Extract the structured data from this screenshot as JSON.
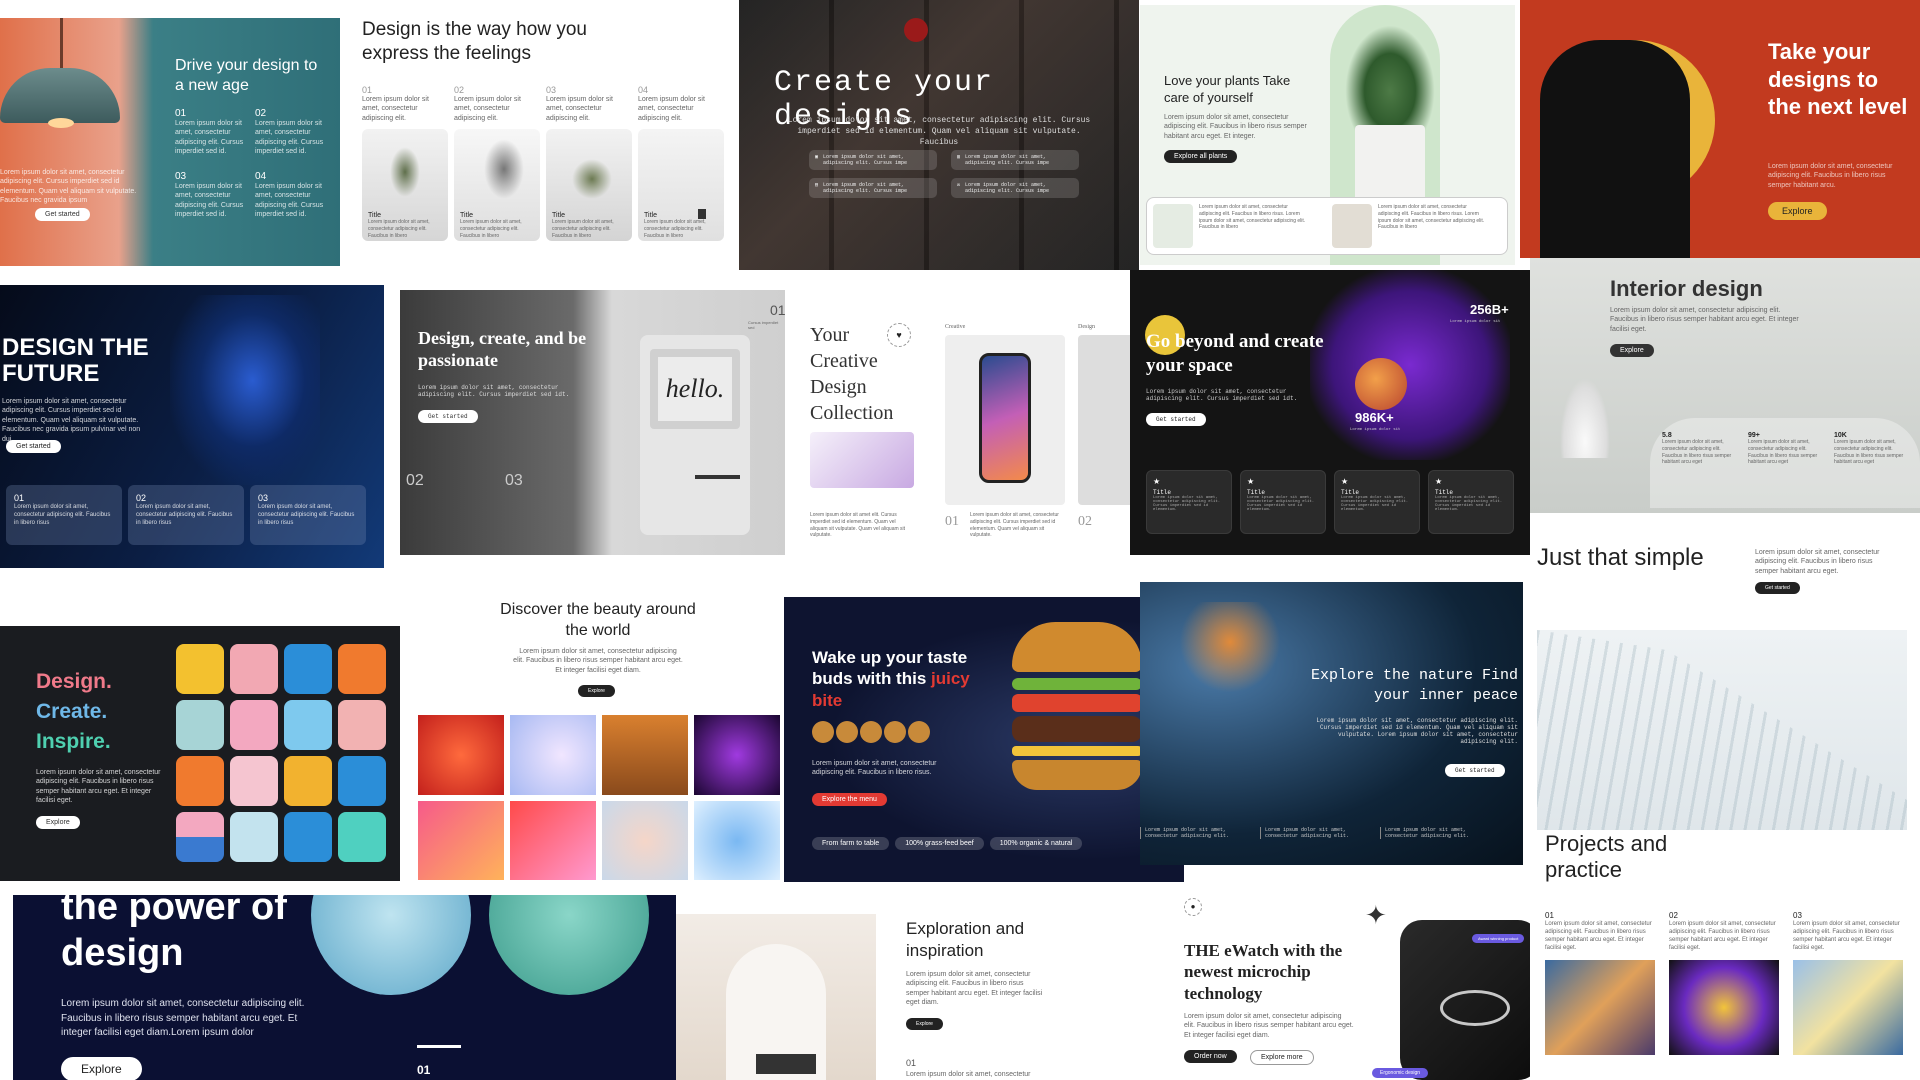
{
  "cards": {
    "lamp": {
      "title": "Drive your design to a new age",
      "nums": [
        "01",
        "02",
        "03",
        "04"
      ],
      "item": "Lorem ipsum dolor sit amet, consectetur adipiscing elit. Cursus imperdiet sed id.",
      "body": "Lorem ipsum dolor sit amet, consectetur adipiscing elit. Cursus imperdiet sed id elementum. Quam vel aliquam sit vulputate. Faucibus nec gravida ipsum",
      "button": "Get started"
    },
    "feelings": {
      "title": "Design is the way how you express the feelings",
      "nums": [
        "01",
        "02",
        "03",
        "04"
      ],
      "desc": "Lorem ipsum dolor sit amet, consectetur adipiscing elit.",
      "tile_title": "Title",
      "tile_text": "Lorem ipsum dolor sit amet, consectetur adipiscing elit. Faucibus in libero"
    },
    "create": {
      "title": "Create your designs",
      "body": "Lorem ipsum dolor sit amet, consectetur adipiscing elit. Cursus imperdiet sed id elementum. Quam vel aliquam sit vulputate. Faucibus",
      "chip": "Lorem ipsum dolor sit amet, adipiscing elit. Cursus impe"
    },
    "plants": {
      "title": "Love your plants Take care of yourself",
      "body": "Lorem ipsum dolor sit amet, consectetur adipiscing elit. Faucibus in libero risus semper habitant arcu eget. Et integer.",
      "button": "Explore all plants",
      "item": "Lorem ipsum dolor sit amet, consectetur adipiscing elit. Faucibus in libero risus. Lorem ipsum dolor sit amet, consectetur adipiscing elit. Faucibus in libero"
    },
    "next": {
      "title": "Take your designs to the next level",
      "body": "Lorem ipsum dolor sit amet, consectetur adipiscing elit. Faucibus in libero risus semper habitant arcu.",
      "button": "Explore"
    },
    "future": {
      "title": "DESIGN THE FUTURE",
      "body": "Lorem ipsum dolor sit amet, consectetur adipiscing elit. Cursus imperdiet sed id elementum. Quam vel aliquam sit vulputate. Faucibus nec gravida ipsum pulvinar vel non dui.",
      "button": "Get started",
      "nums": [
        "01",
        "02",
        "03"
      ],
      "item": "Lorem ipsum dolor sit amet, consectetur adipiscing elit. Faucibus in libero risus"
    },
    "passion": {
      "title": "Design, create, and be passionate",
      "body": "Lorem ipsum dolor sit amet, consectetur adipiscing elit. Cursus imperdiet sed idt.",
      "button": "Get started",
      "nums": [
        "01",
        "02",
        "03"
      ],
      "screen": "hello.",
      "caption": "Cursus imperdiet sed"
    },
    "collection": {
      "title": "Your Creative Design Collection",
      "labels": [
        "Creative",
        "Design"
      ],
      "nums": [
        "01",
        "02"
      ],
      "body": "Lorem ipsum dolor sit amet elit. Cursus imperdiet sed id elementum. Quam vel aliquam sit vulputate. Quam vel aliquam sit vulputate.",
      "small": "Lorem ipsum dolor sit amet, consectetur adipiscing elit. Cursus imperdiet sed id elementum. Quam vel aliquam sit vulputate."
    },
    "space": {
      "title": "Go beyond and create your space",
      "body": "Lorem ipsum dolor sit amet, consectetur adipiscing elit. Cursus imperdiet sed idt.",
      "button": "Get started",
      "stat1": "256B+",
      "stat2": "986K+",
      "stat_sub": "Lorem ipsum dolor sit",
      "tile_title": "Title",
      "tile_text": "Lorem ipsum dolor sit amet, consectetur adipiscing elit. Cursus imperdiet sed id elementum."
    },
    "interior": {
      "title": "Interior design",
      "body": "Lorem ipsum dolor sit amet, consectetur adipiscing elit. Faucibus in libero risus semper habitant arcu eget. Et integer facilisi eget.",
      "button": "Explore",
      "stats": [
        "5.8",
        "99+",
        "10K"
      ],
      "stat_text": "Lorem ipsum dolor sit amet, consectetur adipiscing elit. Faucibus in libero risus semper habitant arcu eget"
    },
    "simple": {
      "title": "Just that simple",
      "body": "Lorem ipsum dolor sit amet, consectetur adipiscing elit. Faucibus in libero risus semper habitant arcu eget.",
      "button": "Get started"
    },
    "inspire": {
      "lines": [
        "Design.",
        "Create.",
        "Inspire."
      ],
      "body": "Lorem ipsum dolor sit amet, consectetur adipiscing elit. Faucibus in libero risus semper habitant arcu eget. Et integer facilisi eget.",
      "button": "Explore"
    },
    "beauty": {
      "title": "Discover the beauty around the world",
      "body": "Lorem ipsum dolor sit amet, consectetur adipiscing elit. Faucibus in libero risus semper habitant arcu eget. Et integer facilisi eget diam.",
      "button": "Explore"
    },
    "burger": {
      "title_a": "Wake up your taste buds with this ",
      "title_b": "juicy bite",
      "body": "Lorem ipsum dolor sit amet, consectetur adipiscing elit. Faucibus in libero risus.",
      "button": "Explore the menu",
      "chips": [
        "From farm to table",
        "100% grass-feed beef",
        "100% organic & natural"
      ]
    },
    "nature": {
      "title": "Explore the nature Find your inner peace",
      "body": "Lorem ipsum dolor sit amet, consectetur adipiscing elit. Cursus imperdiet sed id elementum. Quam vel aliquam sit vulputate. Lorem ipsum dolor sit amet, consectetur adipiscing elit.",
      "button": "Get started",
      "item": "Lorem ipsum dolor sit amet, consectetur adipiscing elit."
    },
    "power": {
      "title": "the power of design",
      "body": "Lorem ipsum dolor sit amet, consectetur adipiscing elit. Faucibus in libero risus semper habitant arcu eget. Et integer facilisi eget diam.Lorem ipsum dolor",
      "button": "Explore",
      "num": "01"
    },
    "exploration": {
      "title": "Exploration and inspiration",
      "body": "Lorem ipsum dolor sit amet, consectetur adipiscing elit. Faucibus in libero risus semper habitant arcu eget. Et integer facilisi eget diam.",
      "button": "Explore",
      "num": "01",
      "foot": "Lorem ipsum dolor sit amet, consectetur"
    },
    "watch": {
      "title": "THE eWatch with the newest microchip technology",
      "body": "Lorem ipsum dolor sit amet, consectetur adipiscing elit. Faucibus in libero risus semper habitant arcu eget. Et integer facilisi eget diam.",
      "button1": "Order now",
      "button2": "Explore more",
      "badge1": "Award winning product",
      "badge2": "Ergonomic design"
    },
    "projects": {
      "title": "Projects and practice",
      "nums": [
        "01",
        "02",
        "03"
      ],
      "item": "Lorem ipsum dolor sit amet, consectetur adipiscing elit. Faucibus in libero risus semper habitant arcu eget. Et integer facilisi eget."
    }
  },
  "colors": {
    "accent_yellow": "#e9b43a",
    "accent_red": "#e33a33",
    "accent_teal": "#3a7f86"
  }
}
